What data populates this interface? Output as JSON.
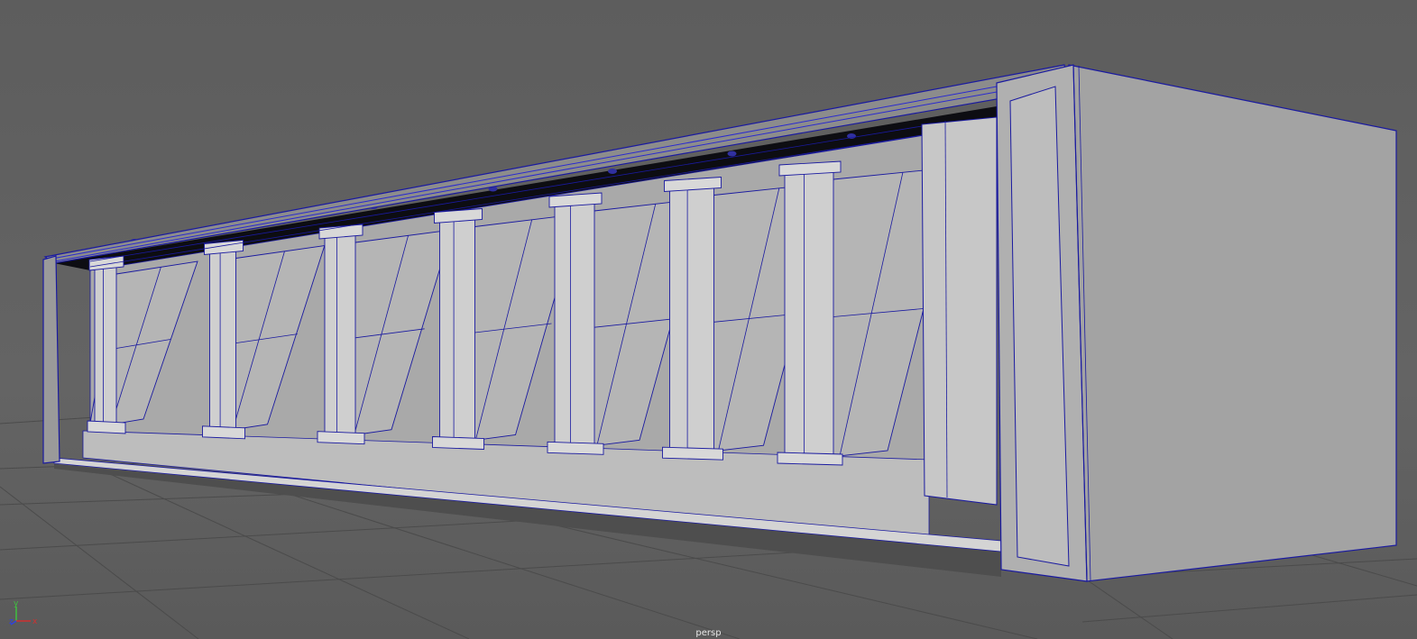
{
  "viewport": {
    "camera_label": "persp",
    "background_color": "#5f5f5f",
    "grid_color": "#4a4a4a",
    "wire_color": "#1a1aa0",
    "highlight_wire_color": "#3a3ad0"
  },
  "axis_gizmo": {
    "x_label": "x",
    "y_label": "y",
    "z_label": "z",
    "x_color": "#d03030",
    "y_color": "#40c040",
    "z_color": "#3040e0"
  },
  "model": {
    "description_icon": "wireframe-mesh-icon",
    "bay_count": 7
  }
}
